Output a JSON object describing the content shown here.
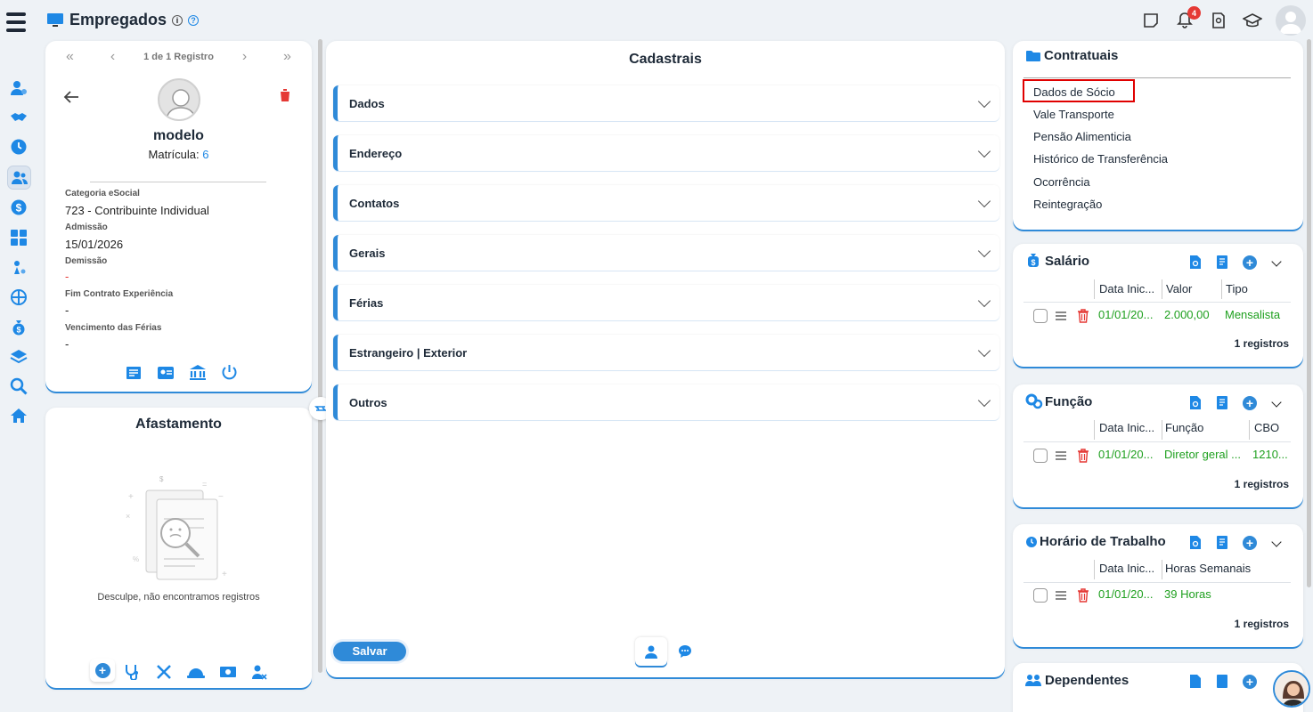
{
  "header": {
    "title": "Empregados",
    "notifications_count": "4"
  },
  "employee": {
    "nav_text": "1 de 1 Registro",
    "nav_first": "«",
    "nav_prev": "‹",
    "nav_next": "›",
    "nav_last": "»",
    "name": "modelo",
    "matricula_label": "Matrícula:",
    "matricula_value": "6",
    "fields": [
      {
        "label": "Categoria eSocial",
        "value": "723 - Contribuinte Individual"
      },
      {
        "label": "Admissão",
        "value": "15/01/2026"
      },
      {
        "label": "Demissão",
        "value": "-"
      },
      {
        "label": "Fim Contrato Experiência",
        "value": "-"
      },
      {
        "label": "Vencimento das Férias",
        "value": "-"
      }
    ]
  },
  "afastamento": {
    "title": "Afastamento",
    "empty_text": "Desculpe, não encontramos registros"
  },
  "cadastrais": {
    "title": "Cadastrais",
    "sections": [
      "Dados",
      "Endereço",
      "Contatos",
      "Gerais",
      "Férias",
      "Estrangeiro | Exterior",
      "Outros"
    ],
    "save_label": "Salvar"
  },
  "contratuais": {
    "title": "Contratuais",
    "items": [
      "Dados de Sócio",
      "Vale Transporte",
      "Pensão Alimenticia",
      "Histórico de Transferência",
      "Ocorrência",
      "Reintegração"
    ]
  },
  "salario": {
    "title": "Salário",
    "headers": [
      "Data Inic...",
      "Valor",
      "Tipo"
    ],
    "row": [
      "01/01/20...",
      "2.000,00",
      "Mensalista"
    ],
    "count": "1 registros"
  },
  "funcao": {
    "title": "Função",
    "headers": [
      "Data Inic...",
      "Função",
      "CBO"
    ],
    "row": [
      "01/01/20...",
      "Diretor geral ...",
      "1210..."
    ],
    "count": "1 registros"
  },
  "horario": {
    "title": "Horário de Trabalho",
    "headers": [
      "Data Inic...",
      "Horas Semanais"
    ],
    "row": [
      "01/01/20...",
      "39 Horas"
    ],
    "count": "1 registros"
  },
  "dependentes": {
    "title": "Dependentes"
  },
  "colors": {
    "accent": "#2f8ad8",
    "highlight_border": "#e00000",
    "success": "#1fa01f",
    "danger": "#e53935"
  }
}
